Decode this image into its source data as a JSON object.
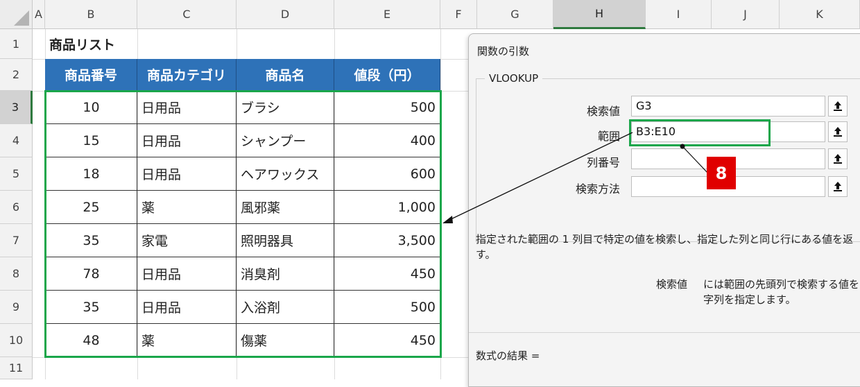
{
  "sheet": {
    "columns": [
      "A",
      "B",
      "C",
      "D",
      "E",
      "F",
      "G",
      "H",
      "I",
      "J",
      "K"
    ],
    "selected_column": "H",
    "rows": [
      "1",
      "2",
      "3",
      "4",
      "5",
      "6",
      "7",
      "8",
      "9",
      "10",
      "11"
    ],
    "selected_row": "3",
    "title": "商品リスト",
    "table": {
      "headers": [
        "商品番号",
        "商品カテゴリ",
        "商品名",
        "値段（円）"
      ],
      "rows": [
        [
          "10",
          "日用品",
          "ブラシ",
          "500"
        ],
        [
          "15",
          "日用品",
          "シャンプー",
          "400"
        ],
        [
          "18",
          "日用品",
          "ヘアワックス",
          "600"
        ],
        [
          "25",
          "薬",
          "風邪薬",
          "1,000"
        ],
        [
          "35",
          "家電",
          "照明器具",
          "3,500"
        ],
        [
          "78",
          "日用品",
          "消臭剤",
          "450"
        ],
        [
          "35",
          "日用品",
          "入浴剤",
          "500"
        ],
        [
          "48",
          "薬",
          "傷薬",
          "450"
        ]
      ]
    }
  },
  "dialog": {
    "title": "関数の引数",
    "function_name": "VLOOKUP",
    "args": [
      {
        "label": "検索値",
        "value": "G3"
      },
      {
        "label": "範囲",
        "value": "B3:E10"
      },
      {
        "label": "列番号",
        "value": ""
      },
      {
        "label": "検索方法",
        "value": ""
      }
    ],
    "description_line1": "指定された範囲の 1 列目で特定の値を検索し、指定した列と同じ行にある値を返",
    "description_line2": "す。",
    "param_name": "検索値",
    "param_desc_line1": "には範囲の先頭列で検索する値を",
    "param_desc_line2": "字列を指定します。",
    "result_label": "数式の結果 ="
  },
  "annotation": {
    "step": "8",
    "badge_color": "#e00000",
    "highlight_color": "#1aa64a"
  },
  "icons": {
    "collapse": "collapse-up-arrow-icon"
  }
}
